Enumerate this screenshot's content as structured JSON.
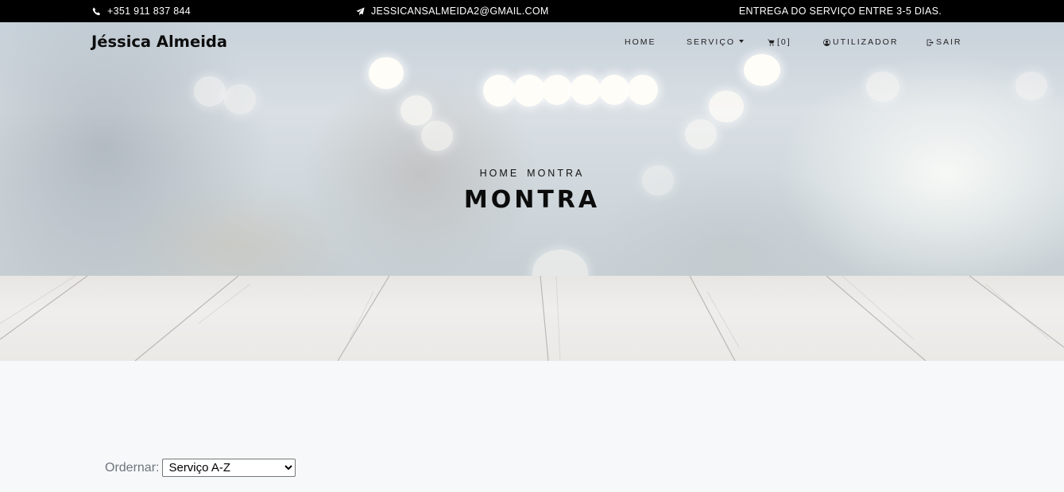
{
  "topbar": {
    "phone_icon": "phone-icon",
    "phone": "+351 911 837 844",
    "email_icon": "paper-plane-icon",
    "email": "JESSICANSALMEIDA2@GMAIL.COM",
    "delivery": "ENTREGA DO SERVIÇO ENTRE 3-5 DIAS."
  },
  "header": {
    "brand": "Jéssica Almeida",
    "nav": {
      "home": "HOME",
      "servico": "SERVIÇO",
      "cart": "[0]",
      "cart_icon": "cart-icon",
      "user": "UTILIZADOR",
      "user_icon": "user-circle-icon",
      "sair": "SAIR",
      "sair_icon": "sign-out-icon"
    }
  },
  "hero": {
    "breadcrumb": [
      "HOME",
      "MONTRA"
    ],
    "title": "MONTRA"
  },
  "sort": {
    "label": "Ordernar:",
    "selected": "Serviço A-Z",
    "options": [
      "Serviço A-Z"
    ]
  },
  "colors": {
    "topbar_bg": "#000000",
    "page_bg": "#f7f8fa",
    "label_gray": "#6c757d"
  }
}
